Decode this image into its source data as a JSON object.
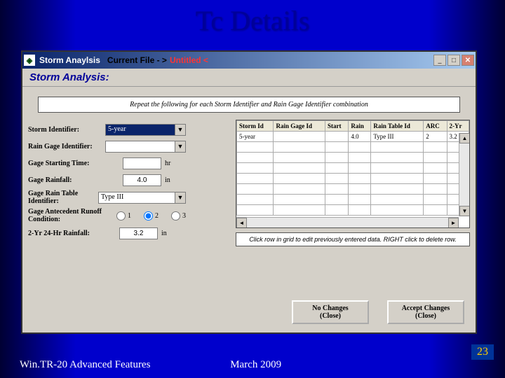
{
  "slide": {
    "title": "Tc Details",
    "footer_left": "Win.TR-20 Advanced Features",
    "footer_date": "March 2009",
    "page_number": "23"
  },
  "window": {
    "icon_glyph": "◈",
    "title_main": "Storm Anaylsis",
    "title_mid": "Current File - >",
    "title_file": "Untitled <",
    "section_header": "Storm Analysis:",
    "instruction": "Repeat the following for each Storm Identifier and Rain Gage Identifier combination"
  },
  "form": {
    "storm_id_label": "Storm Identifier:",
    "storm_id_value": "5-year",
    "rain_gage_label": "Rain Gage Identifier:",
    "rain_gage_value": "",
    "gage_start_label": "Gage Starting Time:",
    "gage_start_value": "",
    "gage_start_unit": "hr",
    "gage_rain_label": "Gage Rainfall:",
    "gage_rain_value": "4.0",
    "gage_rain_unit": "in",
    "rain_table_label": "Gage Rain Table Identifier:",
    "rain_table_value": "Type III",
    "arc_label": "Gage Antecedent Runoff Condition:",
    "arc_options": [
      "1",
      "2",
      "3"
    ],
    "arc_selected": "2",
    "two_yr_label": "2-Yr 24-Hr Rainfall:",
    "two_yr_value": "3.2",
    "two_yr_unit": "in"
  },
  "grid": {
    "headers": [
      "Storm Id",
      "Rain Gage Id",
      "Start",
      "Rain",
      "Rain Table Id",
      "ARC",
      "2-Yr"
    ],
    "row": {
      "storm_id": "5-year",
      "rain_gage_id": "",
      "start": "",
      "rain": "4.0",
      "rain_table": "Type III",
      "arc": "2",
      "two_yr": "3.2"
    },
    "hint": "Click row in grid to edit previously entered data.  RIGHT click to delete row."
  },
  "buttons": {
    "no_changes_l1": "No Changes",
    "no_changes_l2": "(Close)",
    "accept_l1": "Accept Changes",
    "accept_l2": "(Close)"
  }
}
